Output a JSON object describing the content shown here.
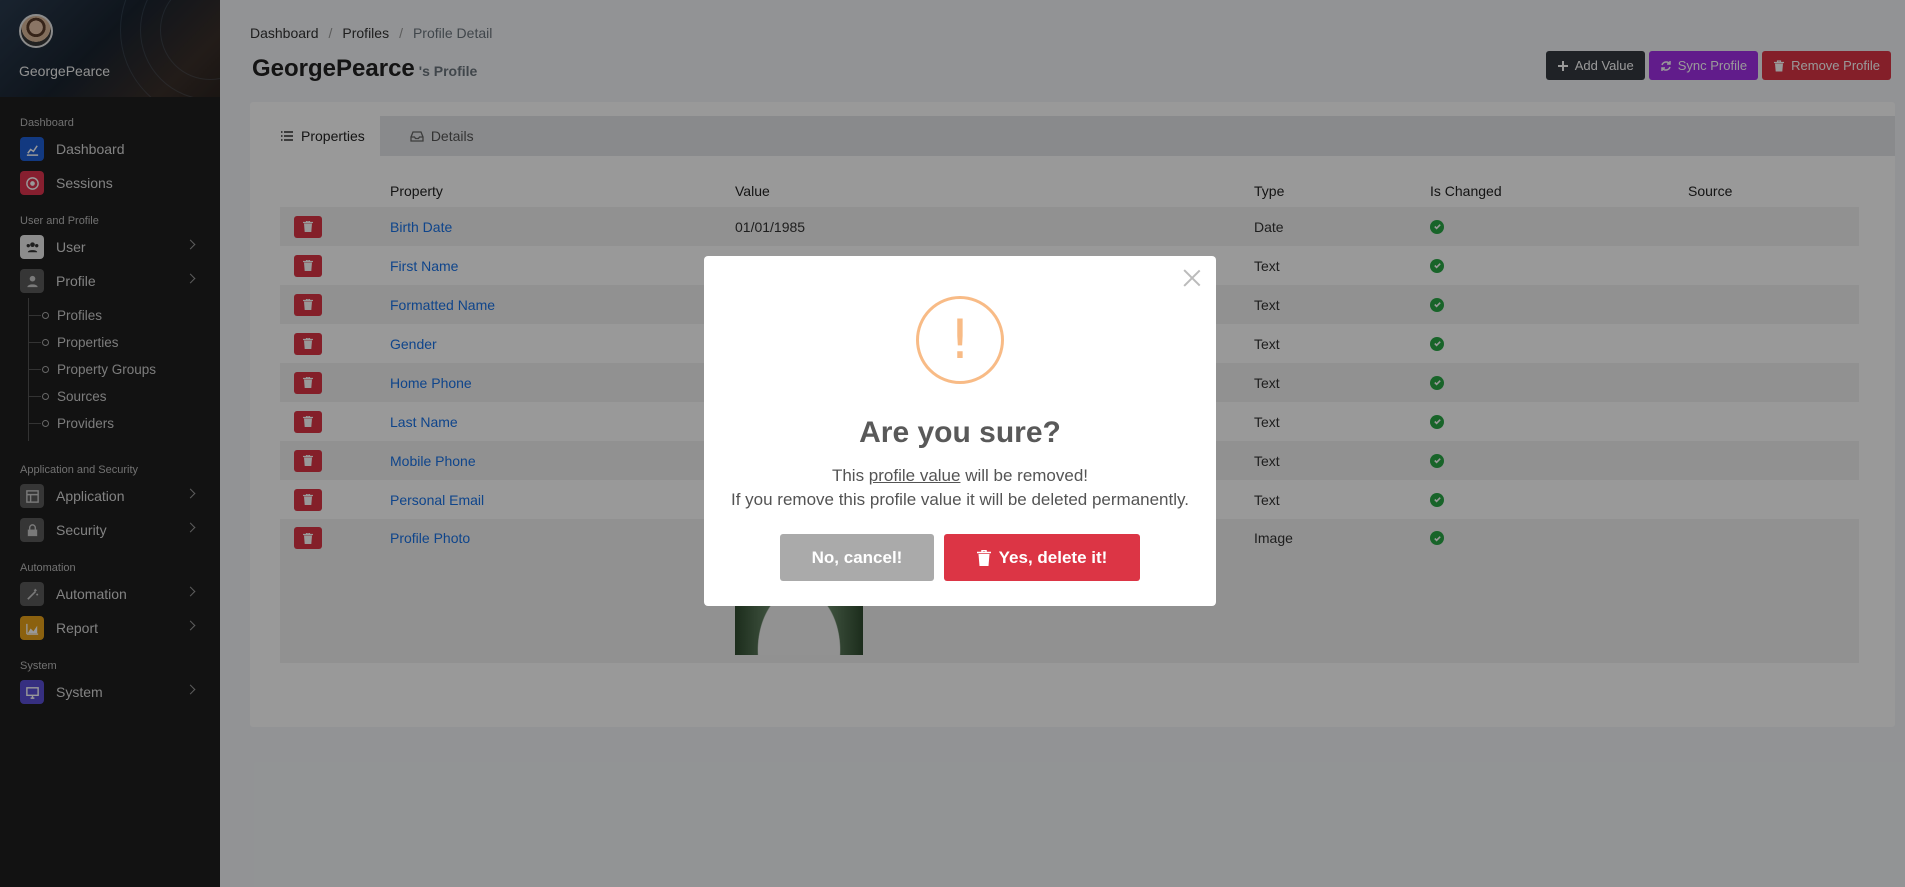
{
  "sidebar": {
    "username": "GeorgePearce",
    "sections": {
      "dashboard": "Dashboard",
      "user_profile": "User and Profile",
      "app_security": "Application and Security",
      "automation": "Automation",
      "system": "System"
    },
    "items": {
      "dashboard": "Dashboard",
      "sessions": "Sessions",
      "user": "User",
      "profile": "Profile",
      "application": "Application",
      "security": "Security",
      "automation": "Automation",
      "report": "Report",
      "system": "System"
    },
    "profile_sub": [
      "Profiles",
      "Properties",
      "Property Groups",
      "Sources",
      "Providers"
    ]
  },
  "breadcrumb": [
    "Dashboard",
    "Profiles",
    "Profile Detail"
  ],
  "page": {
    "title": "GeorgePearce",
    "subtitle": "'s Profile"
  },
  "toolbar": {
    "add_value": "Add Value",
    "sync_profile": "Sync Profile",
    "remove_profile": "Remove Profile"
  },
  "tabs": {
    "properties": "Properties",
    "details": "Details"
  },
  "table": {
    "headers": {
      "property": "Property",
      "value": "Value",
      "type": "Type",
      "is_changed": "Is Changed",
      "source": "Source"
    },
    "rows": [
      {
        "property": "Birth Date",
        "value": "01/01/1985",
        "type": "Date"
      },
      {
        "property": "First Name",
        "value": "",
        "type": "Text"
      },
      {
        "property": "Formatted Name",
        "value": "",
        "type": "Text"
      },
      {
        "property": "Gender",
        "value": "",
        "type": "Text"
      },
      {
        "property": "Home Phone",
        "value": "",
        "type": "Text"
      },
      {
        "property": "Last Name",
        "value": "",
        "type": "Text"
      },
      {
        "property": "Mobile Phone",
        "value": "",
        "type": "Text"
      },
      {
        "property": "Personal Email",
        "value": "",
        "type": "Text"
      },
      {
        "property": "Profile Photo",
        "value": "",
        "type": "Image"
      }
    ]
  },
  "modal": {
    "title": "Are you sure?",
    "line1_pre": "This ",
    "line1_link": "profile value",
    "line1_post": " will be removed!",
    "line2": "If you remove this profile value it will be deleted permanently.",
    "cancel": "No, cancel!",
    "confirm": "Yes, delete it!",
    "icon_glyph": "!"
  },
  "colors": {
    "accent_red": "#dc3545",
    "accent_purple": "#a230e8",
    "warning": "#f8bb86",
    "success": "#28a745"
  }
}
